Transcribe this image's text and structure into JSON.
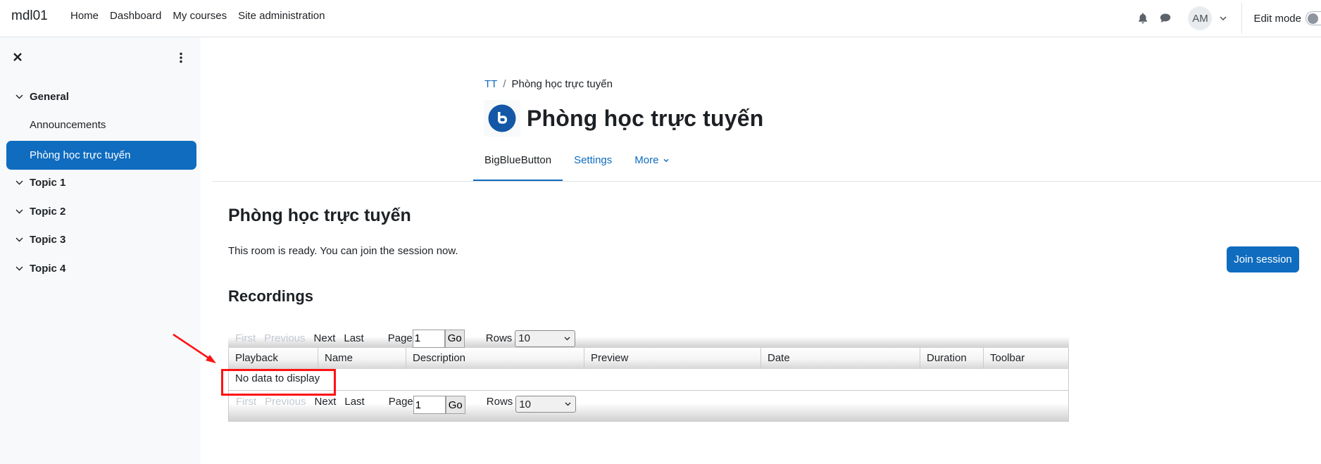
{
  "navbar": {
    "brand": "mdl01",
    "links": [
      "Home",
      "Dashboard",
      "My courses",
      "Site administration"
    ],
    "notifications_icon": "bell-icon",
    "messages_icon": "chat-bubble-icon",
    "avatar_initials": "AM",
    "edit_mode_label": "Edit mode",
    "edit_mode_on": false
  },
  "sidebar": {
    "close_icon": "close-icon",
    "menu_icon": "kebab-icon",
    "sections": [
      {
        "label": "General",
        "items": [
          "Announcements",
          "Phòng học trực tuyến"
        ]
      },
      {
        "label": "Topic 1",
        "items": []
      },
      {
        "label": "Topic 2",
        "items": []
      },
      {
        "label": "Topic 3",
        "items": []
      },
      {
        "label": "Topic 4",
        "items": []
      }
    ],
    "active_item": "Phòng học trực tuyến"
  },
  "header": {
    "breadcrumb": [
      "TT",
      "Phòng học trực tuyến"
    ],
    "breadcrumb_separator": "/",
    "title": "Phòng học trực tuyến",
    "activity_icon": "bigbluebutton-icon",
    "tabs": [
      {
        "label": "BigBlueButton",
        "active": true
      },
      {
        "label": "Settings",
        "active": false
      },
      {
        "label": "More",
        "active": false,
        "dropdown": true
      }
    ]
  },
  "main": {
    "room_title": "Phòng học trực tuyến",
    "status": "This room is ready. You can join the session now.",
    "join_button": "Join session",
    "recordings_heading": "Recordings",
    "pager": {
      "first": "First",
      "previous": "Previous",
      "next": "Next",
      "last": "Last",
      "page_label": "Page",
      "page_value": "1",
      "go": "Go",
      "rows_label": "Rows",
      "rows_value": "10"
    },
    "columns": [
      "Playback",
      "Name",
      "Description",
      "Preview",
      "Date",
      "Duration",
      "Toolbar"
    ],
    "empty_message": "No data to display"
  },
  "colors": {
    "brand_blue": "#0f6cbf",
    "sidebar_bg": "#f8f9fa",
    "annotation_red": "#ff1212"
  }
}
